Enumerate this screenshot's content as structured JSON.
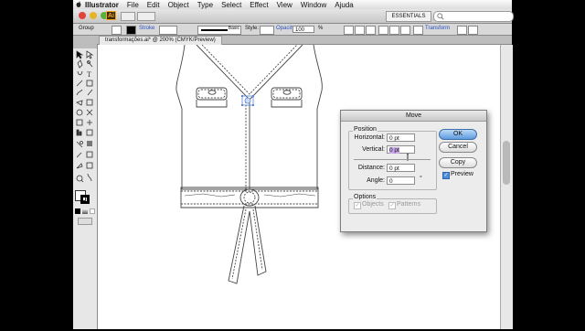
{
  "menubar": {
    "app_name": "Illustrator",
    "menus": [
      "File",
      "Edit",
      "Object",
      "Type",
      "Select",
      "Effect",
      "View",
      "Window",
      "Ajuda"
    ]
  },
  "appbar": {
    "app_badge": "Ai",
    "workspace": "ESSENTIALS"
  },
  "control_panel": {
    "selection": "Group",
    "stroke_label": "Stroke",
    "brush": "Basic",
    "style_label": "Style:",
    "opacity_label": "Opacity",
    "opacity_value": "100",
    "percent": "%",
    "transform_label": "Transform"
  },
  "document": {
    "tab_title": "transformações.ai* @ 200% (CMYK/Preview)"
  },
  "dialog": {
    "title": "Move",
    "position_group": "Position",
    "horizontal_label": "Horizontal:",
    "horizontal_value": "0 pt",
    "vertical_label": "Vertical:",
    "vertical_value": "0 pt",
    "distance_label": "Distance:",
    "distance_value": "0 pt",
    "angle_label": "Angle:",
    "angle_value": "0",
    "degree": "°",
    "options_group": "Options",
    "objects_label": "Objects",
    "patterns_label": "Patterns",
    "ok": "OK",
    "cancel": "Cancel",
    "copy": "Copy",
    "preview_label": "Preview"
  },
  "colors": {
    "accent": "#5e9be0",
    "selection_highlight": "#c8a8e8",
    "app_badge_orange": "#f5a623"
  }
}
